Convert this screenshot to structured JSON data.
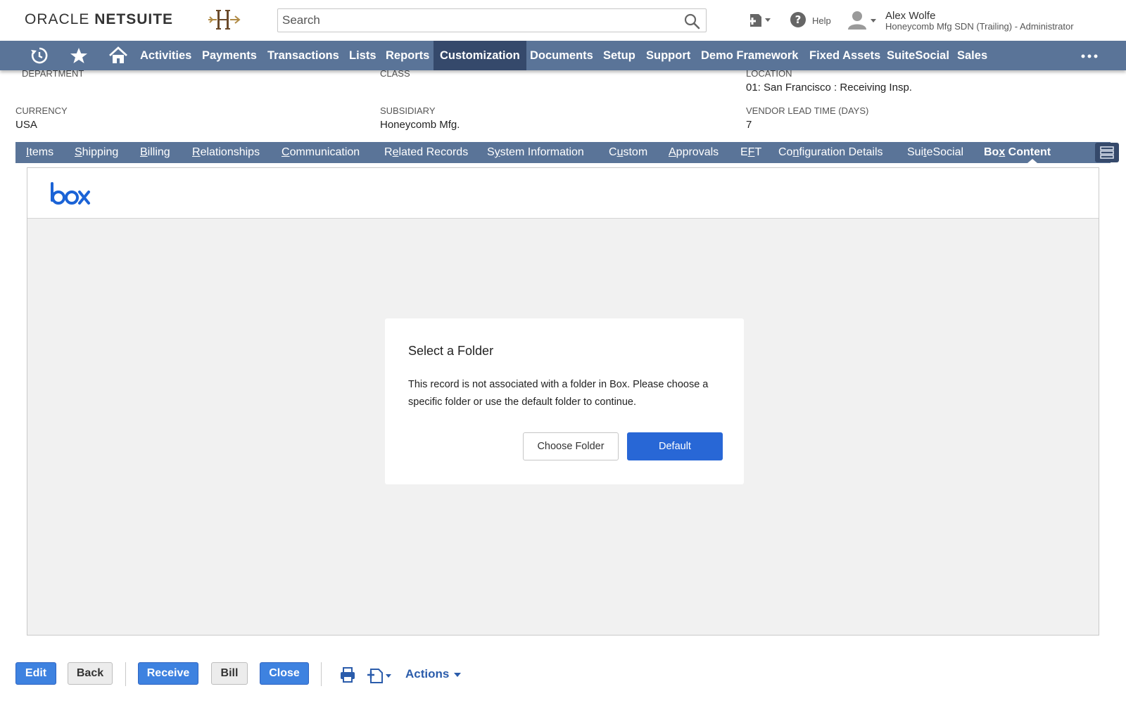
{
  "header": {
    "logo_oracle": "ORACLE",
    "logo_netsuite": "NETSUITE",
    "search_placeholder": "Search",
    "help_label": "Help",
    "user_name": "Alex Wolfe",
    "user_role": "Honeycomb Mfg SDN (Trailing) - Administrator"
  },
  "nav": {
    "items": [
      "Activities",
      "Payments",
      "Transactions",
      "Lists",
      "Reports",
      "Customization",
      "Documents",
      "Setup",
      "Support",
      "Demo Framework",
      "Fixed Assets",
      "SuiteSocial",
      "Sales"
    ],
    "active": "Customization"
  },
  "fields": {
    "department_label": "DEPARTMENT",
    "class_label": "CLASS",
    "location_label": "LOCATION",
    "location_value": "01: San Francisco : Receiving Insp.",
    "currency_label": "CURRENCY",
    "currency_value": "USA",
    "subsidiary_label": "SUBSIDIARY",
    "subsidiary_value": "Honeycomb Mfg.",
    "lead_time_label": "VENDOR LEAD TIME (DAYS)",
    "lead_time_value": "7"
  },
  "subtabs": {
    "items": [
      {
        "u": "I",
        "rest": "tems"
      },
      {
        "u": "S",
        "rest": "hipping"
      },
      {
        "u": "B",
        "rest": "illing"
      },
      {
        "u": "R",
        "rest": "elationships"
      },
      {
        "u": "C",
        "rest": "ommunication"
      },
      {
        "pre": "R",
        "u": "e",
        "rest": "lated Records"
      },
      {
        "pre": "S",
        "u": "y",
        "rest": "stem Information"
      },
      {
        "pre": "C",
        "u": "u",
        "rest": "stom"
      },
      {
        "u": "A",
        "rest": "pprovals"
      },
      {
        "pre": "E",
        "u": "F",
        "rest": "T"
      },
      {
        "pre": "Co",
        "u": "n",
        "rest": "figuration Details"
      },
      {
        "pre": "Sui",
        "u": "t",
        "rest": "eSocial"
      },
      {
        "pre": "Bo",
        "u": "x",
        "rest": " Content"
      }
    ],
    "active": "Box Content"
  },
  "box": {
    "logo_text": "box",
    "dialog_title": "Select a Folder",
    "dialog_body": "This record is not associated with a folder in Box. Please choose a specific folder or use the default folder to continue.",
    "choose_label": "Choose Folder",
    "default_label": "Default",
    "accent": "#2867d6"
  },
  "footer": {
    "edit": "Edit",
    "back": "Back",
    "receive": "Receive",
    "bill": "Bill",
    "close": "Close",
    "actions": "Actions"
  },
  "colors": {
    "nav_bg": "#5a7498",
    "nav_active": "#35496b",
    "primary_button": "#3e82e0"
  }
}
